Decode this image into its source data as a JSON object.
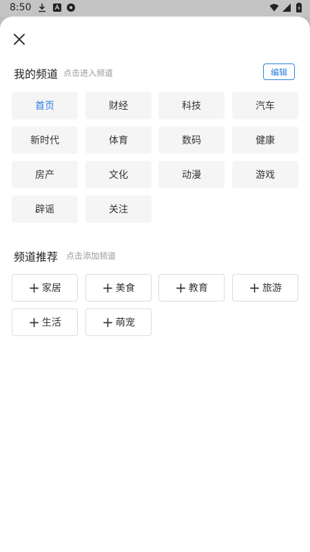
{
  "status_bar": {
    "time": "8:50"
  },
  "my_channels": {
    "title": "我的频道",
    "hint": "点击进入频道",
    "edit_label": "编辑",
    "items": [
      {
        "label": "首页",
        "active": true
      },
      {
        "label": "财经"
      },
      {
        "label": "科技"
      },
      {
        "label": "汽车"
      },
      {
        "label": "新时代"
      },
      {
        "label": "体育"
      },
      {
        "label": "数码"
      },
      {
        "label": "健康"
      },
      {
        "label": "房产"
      },
      {
        "label": "文化"
      },
      {
        "label": "动漫"
      },
      {
        "label": "游戏"
      },
      {
        "label": "辟谣"
      },
      {
        "label": "关注"
      }
    ]
  },
  "recommended": {
    "title": "频道推荐",
    "hint": "点击添加频道",
    "items": [
      {
        "label": "家居"
      },
      {
        "label": "美食"
      },
      {
        "label": "教育"
      },
      {
        "label": "旅游"
      },
      {
        "label": "生活"
      },
      {
        "label": "萌宠"
      }
    ]
  },
  "colors": {
    "accent": "#2b7de0",
    "tile_bg": "#f5f5f5",
    "scrim": "#bdbdbd"
  }
}
